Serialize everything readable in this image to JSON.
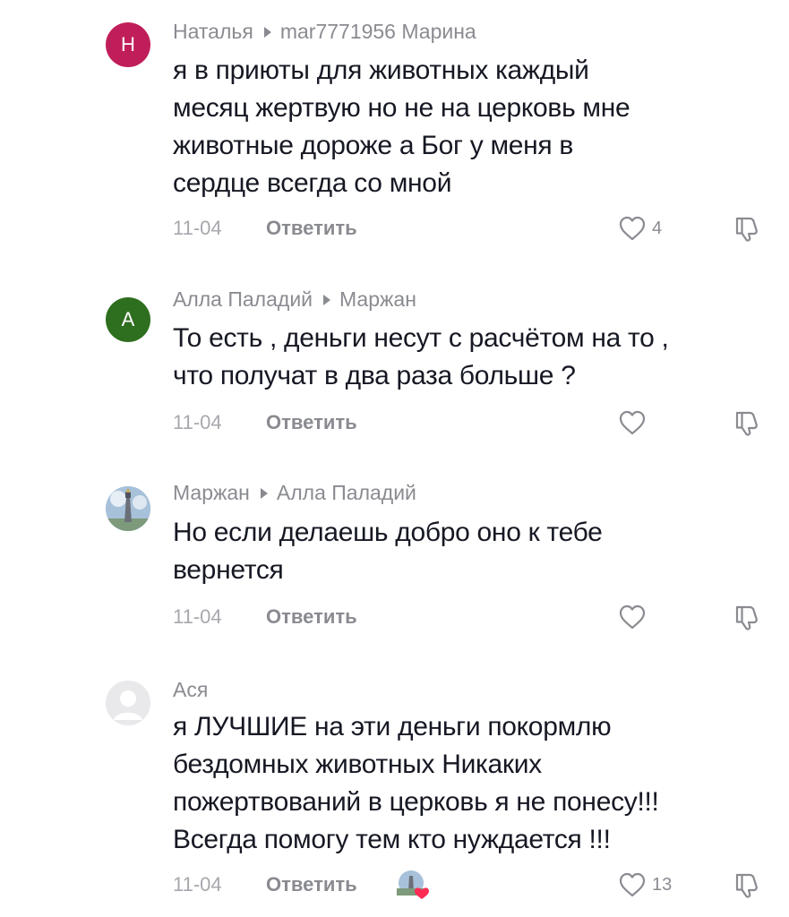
{
  "comments": [
    {
      "author": "Наталья",
      "reply_to": "mar7771956 Марина",
      "avatar_letter": "Н",
      "avatar_color": "#c01e5a",
      "lines": [
        "я в приюты для животных каждый",
        "месяц жертвую но не на церковь мне",
        "животные дороже а Бог у меня в",
        "сердце всегда со мной"
      ],
      "date": "11-04",
      "reply_label": "Ответить",
      "likes": "4"
    },
    {
      "author": "Алла Паладий",
      "reply_to": "Маржан",
      "avatar_letter": "А",
      "avatar_color": "#2e6e1f",
      "lines": [
        "То есть , деньги несут с расчётом на то ,",
        "что получат в два раза больше ?"
      ],
      "date": "11-04",
      "reply_label": "Ответить",
      "likes": ""
    },
    {
      "author": "Маржан",
      "reply_to": "Алла Паладий",
      "avatar_letter": "",
      "avatar_color": "#9fb7cf",
      "lines": [
        "Но если делаешь добро оно к тебе",
        "вернется"
      ],
      "date": "11-04",
      "reply_label": "Ответить",
      "likes": ""
    },
    {
      "author": "Ася",
      "reply_to": "",
      "avatar_letter": "",
      "avatar_color": "#e9e9ec",
      "lines": [
        "я ЛУЧШИЕ на эти деньги покормлю",
        "бездомных животных Никаких",
        "пожертвований в церковь я не понесу!!!",
        "Всегда помогу тем кто нуждается !!!"
      ],
      "date": "11-04",
      "reply_label": "Ответить",
      "likes": "13"
    }
  ],
  "icons": {
    "like": "heart-outline-icon",
    "dislike": "thumbs-down-icon"
  },
  "colors": {
    "text": "#161823",
    "secondary": "#8a8b91",
    "date": "#a7a8ad"
  }
}
